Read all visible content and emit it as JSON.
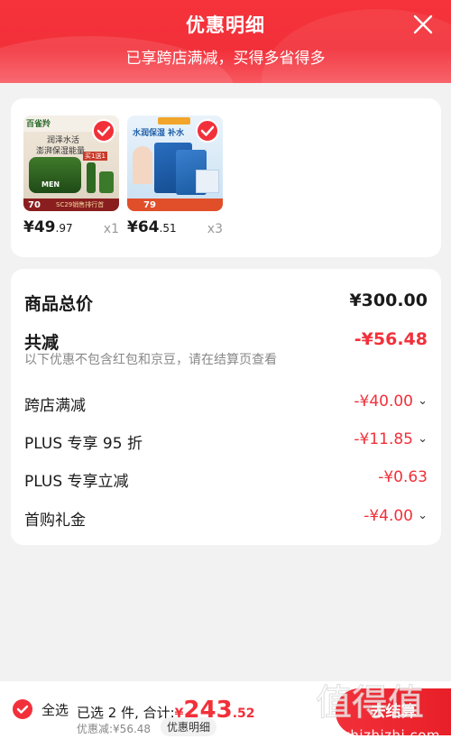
{
  "header": {
    "title": "优惠明细",
    "subtitle": "已享跨店满减，买得多省得多"
  },
  "products": [
    {
      "price_main": "¥49",
      "price_decimal": ".97",
      "qty": "x1",
      "thumb_texts": [
        "百雀羚",
        "润泽水活",
        "澎湃保湿能量",
        "MEN",
        "买1送1",
        "SC29销售排行首",
        "70"
      ]
    },
    {
      "price_main": "¥64",
      "price_decimal": ".51",
      "qty": "x3",
      "thumb_texts": [
        "水润保湿 补水",
        "79"
      ]
    }
  ],
  "prices": {
    "total_label": "商品总价",
    "total_value": "¥300.00",
    "reduce_label": "共减",
    "reduce_value": "-¥56.48",
    "note": "以下优惠不包含红包和京豆，请在结算页查看",
    "items": [
      {
        "label": "跨店满减",
        "value": "-¥40.00",
        "expandable": true
      },
      {
        "label": "PLUS 专享 95 折",
        "value": "-¥11.85",
        "expandable": true
      },
      {
        "label": "PLUS 专享立减",
        "value": "-¥0.63",
        "expandable": false
      },
      {
        "label": "首购礼金",
        "value": "-¥4.00",
        "expandable": true
      }
    ]
  },
  "footer": {
    "select_all": "全选",
    "summary_prefix": "已选 2 件, 合计:",
    "amount_symbol": "¥",
    "amount_int": "243",
    "amount_dec": ".52",
    "discount_line": "优惠减:¥56.48",
    "detail_tag": "优惠明细",
    "checkout_label": "去结算"
  },
  "watermark": {
    "site": "zhizhizhi.com",
    "logo_text": "值得值"
  },
  "colors": {
    "accent": "#f2303a",
    "background": "#f2f2f2"
  }
}
